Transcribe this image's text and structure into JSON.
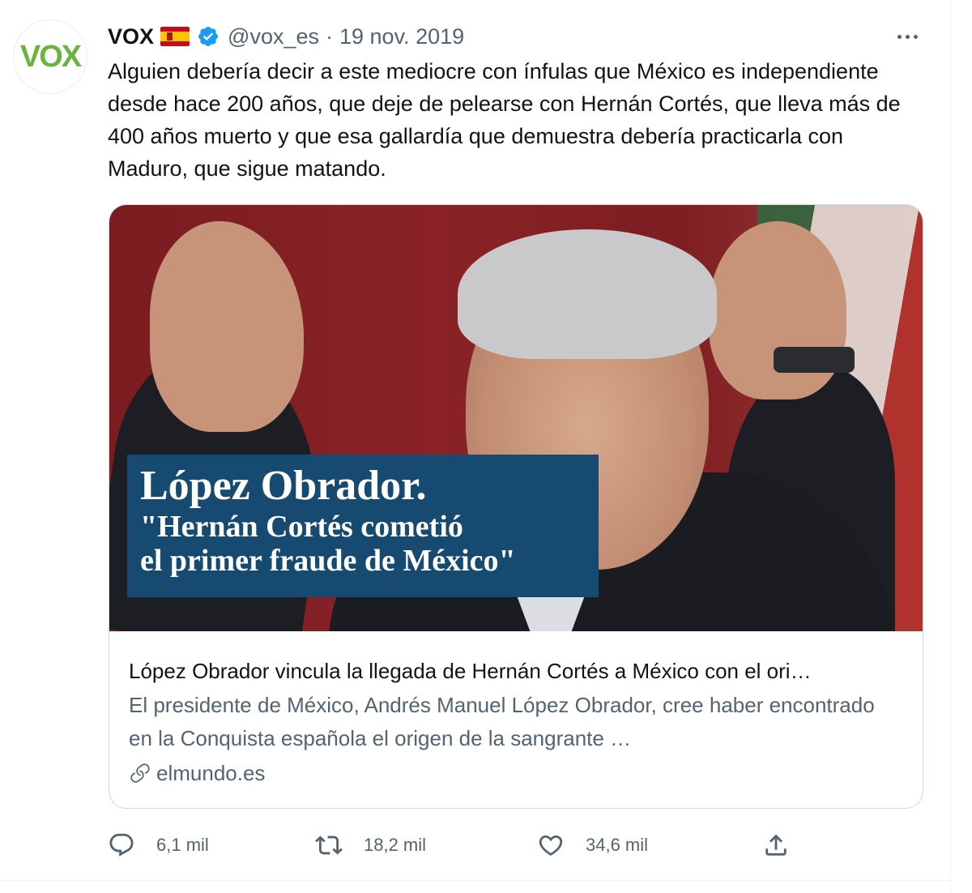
{
  "tweet": {
    "display_name": "VOX",
    "avatar_text": "VOX",
    "handle": "@vox_es",
    "separator": "·",
    "date": "19 nov. 2019",
    "text": "Alguien debería decir a este mediocre con ínfulas que México es independiente desde hace 200 años, que deje de pelearse con Hernán Cortés, que lleva más de 400 años muerto y que esa gallardía que demuestra debería practicarla con Maduro, que sigue matando."
  },
  "card": {
    "image_headline_title": "López Obrador.",
    "image_headline_quote_line1": "\"Hernán Cortés cometió",
    "image_headline_quote_line2": "el primer fraude de México\"",
    "title": "López Obrador vincula la llegada de Hernán Cortés a México con el ori…",
    "description": "El presidente de México, Andrés Manuel López Obrador, cree haber encontrado en la Conquista española el origen de la sangrante …",
    "domain": "elmundo.es"
  },
  "actions": {
    "reply_count": "6,1 mil",
    "retweet_count": "18,2 mil",
    "like_count": "34,6 mil"
  },
  "colors": {
    "text_primary": "#0f1419",
    "text_secondary": "#536471",
    "verified_blue": "#1d9bf0",
    "vox_green": "#6cb33f",
    "headline_bg": "#174a70",
    "border": "#cfd9de"
  },
  "icons": {
    "verified": "verified-badge-icon",
    "more": "more-options-icon",
    "link": "link-icon",
    "reply": "reply-icon",
    "retweet": "retweet-icon",
    "like": "heart-icon",
    "share": "share-icon"
  }
}
